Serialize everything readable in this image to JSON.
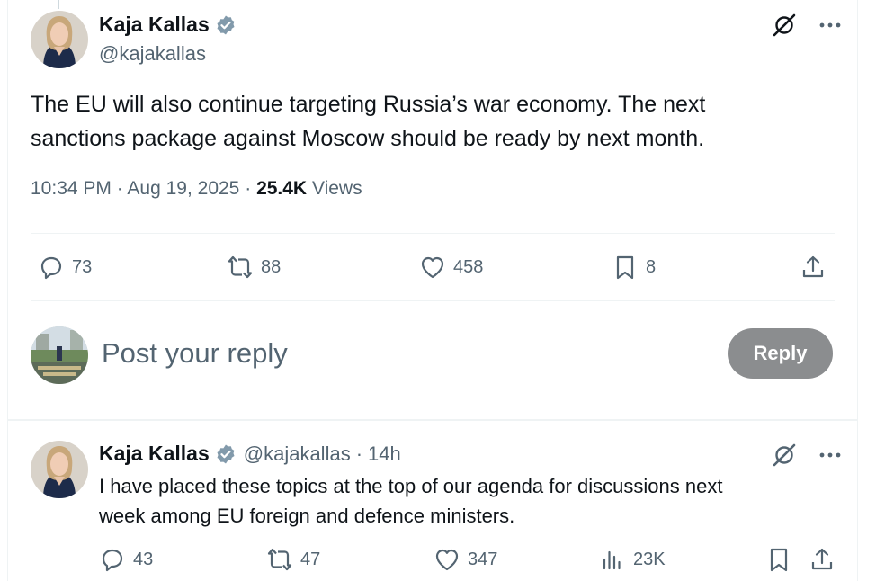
{
  "main_tweet": {
    "author_name": "Kaja Kallas",
    "handle": "@kajakallas",
    "text_line1": "The EU will also continue targeting Russia’s war economy. The next",
    "text_line2": "sanctions package against Moscow should be ready by next month.",
    "time": "10:34 PM",
    "date": "Aug 19, 2025",
    "views_count": "25.4K",
    "views_label": "Views",
    "sep1": "·",
    "sep2": "·",
    "replies": "73",
    "reposts": "88",
    "likes": "458",
    "bookmarks": "8"
  },
  "composer": {
    "placeholder": "Post your reply",
    "reply_button": "Reply"
  },
  "reply_tweet": {
    "author_name": "Kaja Kallas",
    "handle": "@kajakallas",
    "sep": "·",
    "age": "14h",
    "text_line1": "I have placed these topics at the top of our agenda for discussions next",
    "text_line2": "week among EU foreign and defence ministers.",
    "replies": "43",
    "reposts": "47",
    "likes": "347",
    "views": "23K"
  },
  "colors": {
    "text": "#0f1419",
    "secondary": "#536471",
    "verified": "#829aab",
    "reply_button_bg": "#8b8d8f",
    "divider": "#eff3f4"
  },
  "icons": [
    "verified-badge-icon",
    "grok-icon",
    "more-icon",
    "reply-icon",
    "repost-icon",
    "like-icon",
    "bookmark-icon",
    "share-icon",
    "views-icon"
  ]
}
